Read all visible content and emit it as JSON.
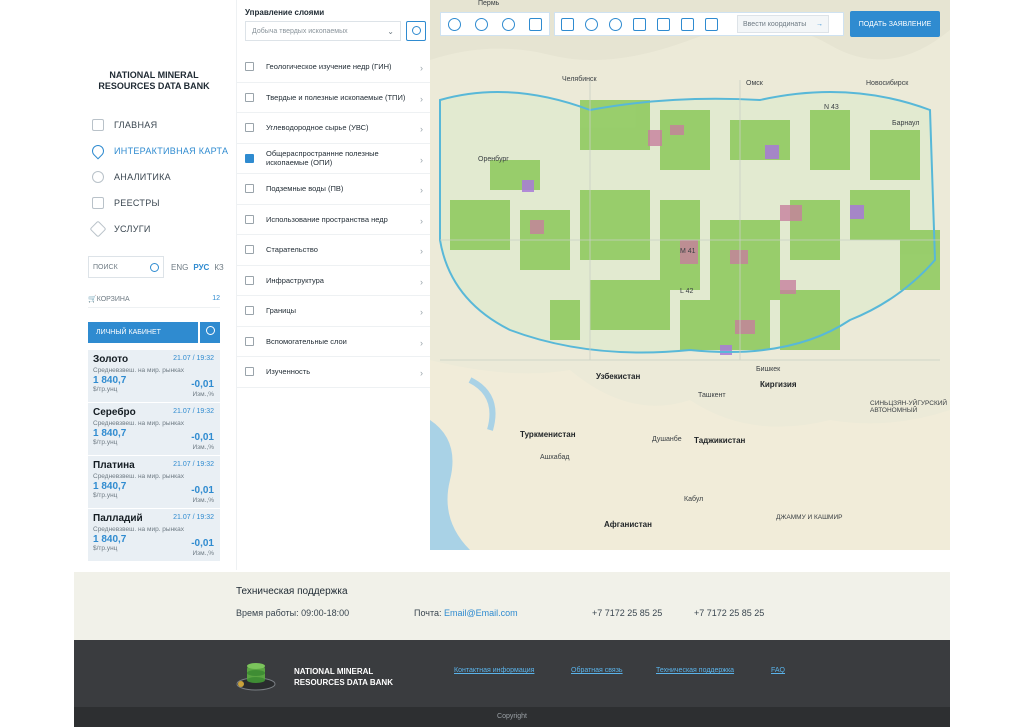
{
  "brand": {
    "line1": "NATIONAL MINERAL",
    "line2": "RESOURCES DATA BANK"
  },
  "nav": [
    {
      "label": "ГЛАВНАЯ",
      "icon": "home-icon",
      "active": false
    },
    {
      "label": "ИНТЕРАКТИВНАЯ КАРТА",
      "icon": "map-pin-icon",
      "active": true
    },
    {
      "label": "АНАЛИТИКА",
      "icon": "pie-chart-icon",
      "active": false
    },
    {
      "label": "РЕЕСТРЫ",
      "icon": "grid-icon",
      "active": false
    },
    {
      "label": "УСЛУГИ",
      "icon": "layers-icon",
      "active": false
    }
  ],
  "search": {
    "placeholder": "ПОИСК"
  },
  "langs": [
    "ENG",
    "РУС",
    "КЗ"
  ],
  "active_lang": "РУС",
  "cart": {
    "label": "КОРЗИНА",
    "count": "12"
  },
  "cabinet": {
    "label": "ЛИЧНЫЙ КАБИНЕТ"
  },
  "prices": [
    {
      "name": "Золото",
      "date": "21.07 / 19:32",
      "sub": "Средневзвеш. на мир. рынках",
      "value": "1 840,7",
      "change": "-0,01",
      "unit": "$/тр.унц",
      "unit2": "Изм.,%"
    },
    {
      "name": "Серебро",
      "date": "21.07 / 19:32",
      "sub": "Средневзвеш. на мир. рынках",
      "value": "1 840,7",
      "change": "-0,01",
      "unit": "$/тр.унц",
      "unit2": "Изм.,%"
    },
    {
      "name": "Платина",
      "date": "21.07 / 19:32",
      "sub": "Средневзвеш. на мир. рынках",
      "value": "1 840,7",
      "change": "-0,01",
      "unit": "$/тр.унц",
      "unit2": "Изм.,%"
    },
    {
      "name": "Палладий",
      "date": "21.07 / 19:32",
      "sub": "Средневзвеш. на мир. рынках",
      "value": "1 840,7",
      "change": "-0,01",
      "unit": "$/тр.унц",
      "unit2": "Изм.,%"
    }
  ],
  "layers": {
    "title": "Управление слоями",
    "select_value": "Добыча твердых ископаемых",
    "items": [
      {
        "label": "Геологическое изучение недр (ГИН)",
        "checked": false
      },
      {
        "label": "Твердые и полезные ископаемые (ТПИ)",
        "checked": false
      },
      {
        "label": "Углеводородное сырье (УВС)",
        "checked": false
      },
      {
        "label": "Общераспространнне полезные ископаемые (ОПИ)",
        "checked": true
      },
      {
        "label": "Подземные воды (ПВ)",
        "checked": false
      },
      {
        "label": "Использование пространства недр",
        "checked": false
      },
      {
        "label": "Старательство",
        "checked": false
      },
      {
        "label": "Инфраструктура",
        "checked": false
      },
      {
        "label": "Границы",
        "checked": false
      },
      {
        "label": "Вспомогательные слои",
        "checked": false
      },
      {
        "label": "Изученность",
        "checked": false
      }
    ]
  },
  "map": {
    "coord_placeholder": "Ввести координаты",
    "apply_button": "ПОДАТЬ ЗАЯВЛЕНИЕ",
    "labels": {
      "perm": "Пермь",
      "chelyabinsk": "Челябинск",
      "omsk": "Омск",
      "novosibirsk": "Новосибирск",
      "orenburg": "Оренбург",
      "barnaul": "Барнаул",
      "uzbekistan": "Узбекистан",
      "kyrgyzstan": "Киргизия",
      "turkmenistan": "Туркменистан",
      "tajikistan": "Таджикистан",
      "afghanistan": "Афганистан",
      "tashkent": "Ташкент",
      "dushanbe": "Душанбе",
      "ashgabat": "Ашхабад",
      "kabul": "Кабул",
      "bishkek": "Бишкек",
      "xinjiang": "СИНЬЦЗЯН-УЙГУРСКИЙ АВТОНОМНЫЙ",
      "jammu": "ДЖАММУ И КАШМИР",
      "grid_l42": "L 42",
      "grid_m41": "M 41",
      "grid_n43": "N 43"
    }
  },
  "support": {
    "title": "Техническая поддержка",
    "hours": "Время работы: 09:00-18:00",
    "mail_label": "Почта:",
    "mail": "Email@Email.com",
    "phone1": "+7 7172 25 85 25",
    "phone2": "+7 7172 25 85 25"
  },
  "footer": {
    "brand1": "NATIONAL MINERAL",
    "brand2": "RESOURCES DATA BANK",
    "links": [
      "Контактная информация",
      "Обратная связь",
      "Техническая поддержка",
      "FAQ"
    ],
    "copyright": "Copyright"
  },
  "colors": {
    "accent": "#2f8bd0",
    "footer_bg": "#3a3c3f",
    "support_bg": "#f1f1e9",
    "map_land": "#ecead8",
    "map_green": "#8cc95a",
    "map_pink": "#c77f9d",
    "map_purple": "#a87ad8"
  }
}
